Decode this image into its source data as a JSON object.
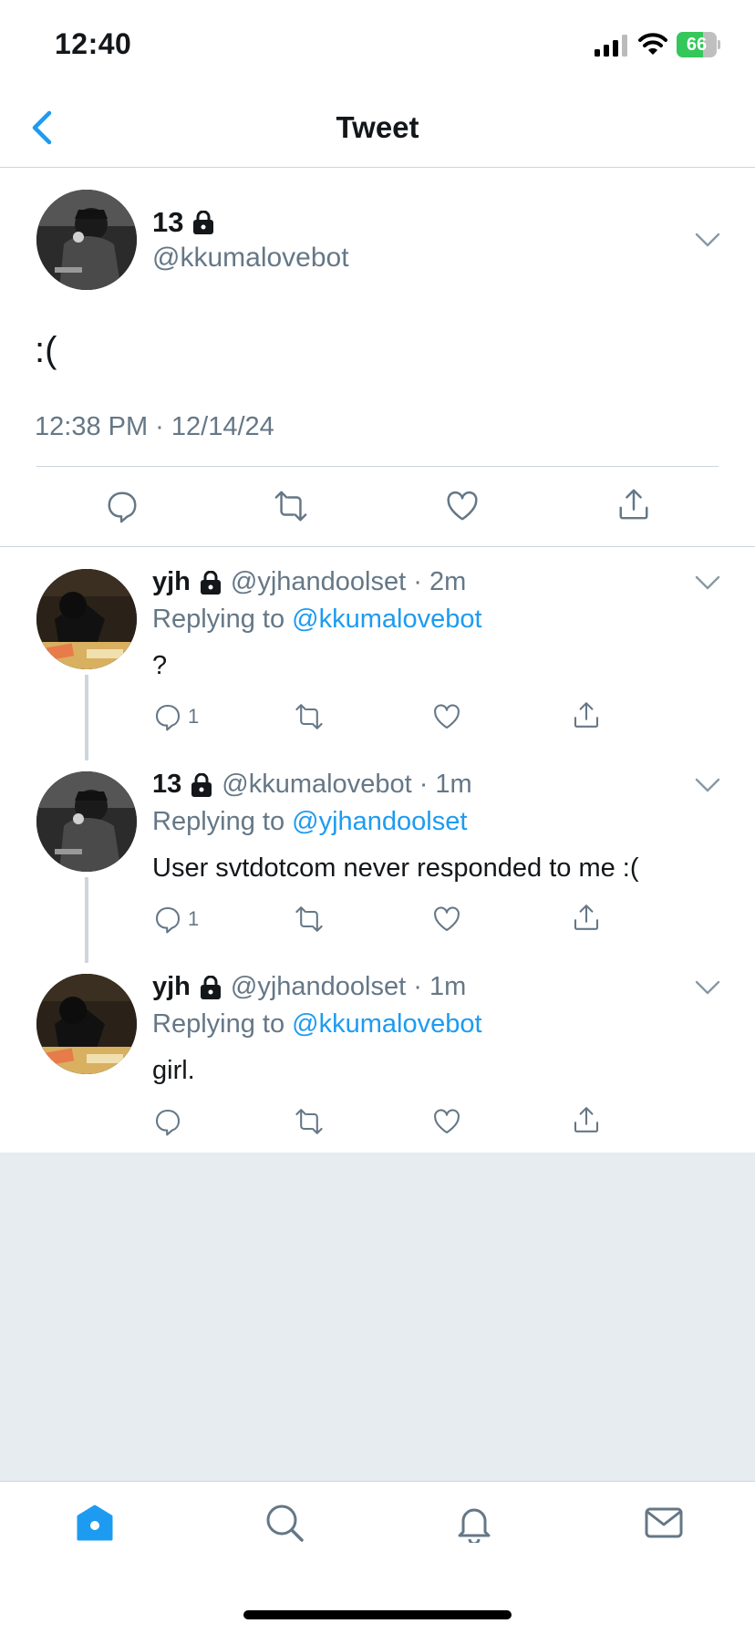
{
  "status_bar": {
    "time": "12:40",
    "battery": "66",
    "battery_level": 0.66
  },
  "header": {
    "title": "Tweet"
  },
  "main_tweet": {
    "name": "13",
    "handle": "@kkumalovebot",
    "text": ":(",
    "timestamp": "12:38 PM · 12/14/24"
  },
  "replies": [
    {
      "name": "yjh",
      "handle": "@yjhandoolset",
      "time": "2m",
      "replying_prefix": "Replying to",
      "replying_to": "@kkumalovebot",
      "text": "?",
      "reply_count": "1"
    },
    {
      "name": "13",
      "handle": "@kkumalovebot",
      "time": "1m",
      "replying_prefix": "Replying to",
      "replying_to": "@yjhandoolset",
      "text": "User svtdotcom never responded to me :(",
      "reply_count": "1"
    },
    {
      "name": "yjh",
      "handle": "@yjhandoolset",
      "time": "1m",
      "replying_prefix": "Replying to",
      "replying_to": "@kkumalovebot",
      "text": "girl.",
      "reply_count": ""
    }
  ],
  "tab_bar": {
    "items": [
      "home-icon",
      "search-icon",
      "notifications-icon",
      "messages-icon"
    ],
    "active": "home-icon"
  },
  "colors": {
    "accent": "#1d9bf0",
    "secondary_text": "#657786",
    "divider": "#ced5dc",
    "background_grey": "#e6ecf0"
  }
}
